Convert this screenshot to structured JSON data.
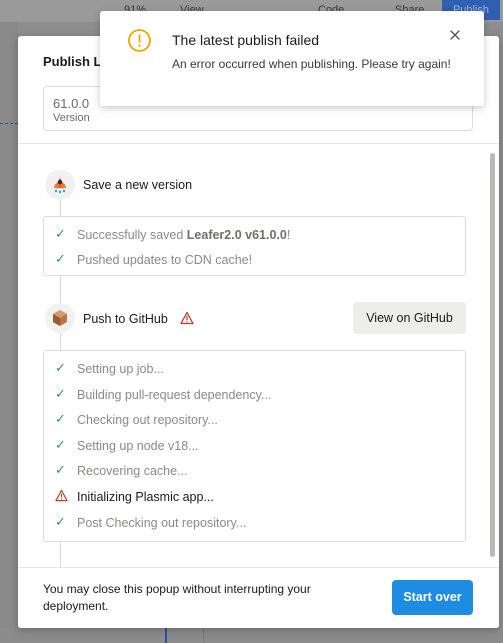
{
  "background": {
    "zoom": "91%",
    "view_label": "View",
    "code_label": "Code",
    "share_label": "Share",
    "publish_label": "Publish"
  },
  "dialog": {
    "title": "Publish Le",
    "version": {
      "value": "61.0.0",
      "label": "Version"
    },
    "steps": [
      {
        "title": "Save a new version",
        "icon": "leafer-logo-icon",
        "log": [
          {
            "status": "success",
            "prefix": "Successfully saved ",
            "bold": "Leafer2.0 v61.0.0",
            "suffix": "!"
          },
          {
            "status": "success",
            "text": "Pushed updates to CDN cache!"
          }
        ]
      },
      {
        "title": "Push to GitHub",
        "icon": "package-icon",
        "status_icon": "warning-icon",
        "action_label": "View on GitHub",
        "log": [
          {
            "status": "success",
            "text": "Setting up job..."
          },
          {
            "status": "success",
            "text": "Building pull-request dependency..."
          },
          {
            "status": "success",
            "text": "Checking out repository..."
          },
          {
            "status": "success",
            "text": "Setting up node v18..."
          },
          {
            "status": "success",
            "text": "Recovering cache..."
          },
          {
            "status": "warning",
            "text": "Initializing Plasmic app..."
          },
          {
            "status": "success",
            "text": "Post Checking out repository..."
          }
        ]
      }
    ],
    "footer_text": "You may close this popup without interrupting your deployment.",
    "start_over_label": "Start over"
  },
  "toast": {
    "title": "The latest publish failed",
    "message": "An error occurred when publishing. Please try again!"
  },
  "colors": {
    "success": "#2e9c4e",
    "warning": "#c0392b",
    "toast_warning": "#f0a400",
    "primary": "#1e8ce3"
  }
}
